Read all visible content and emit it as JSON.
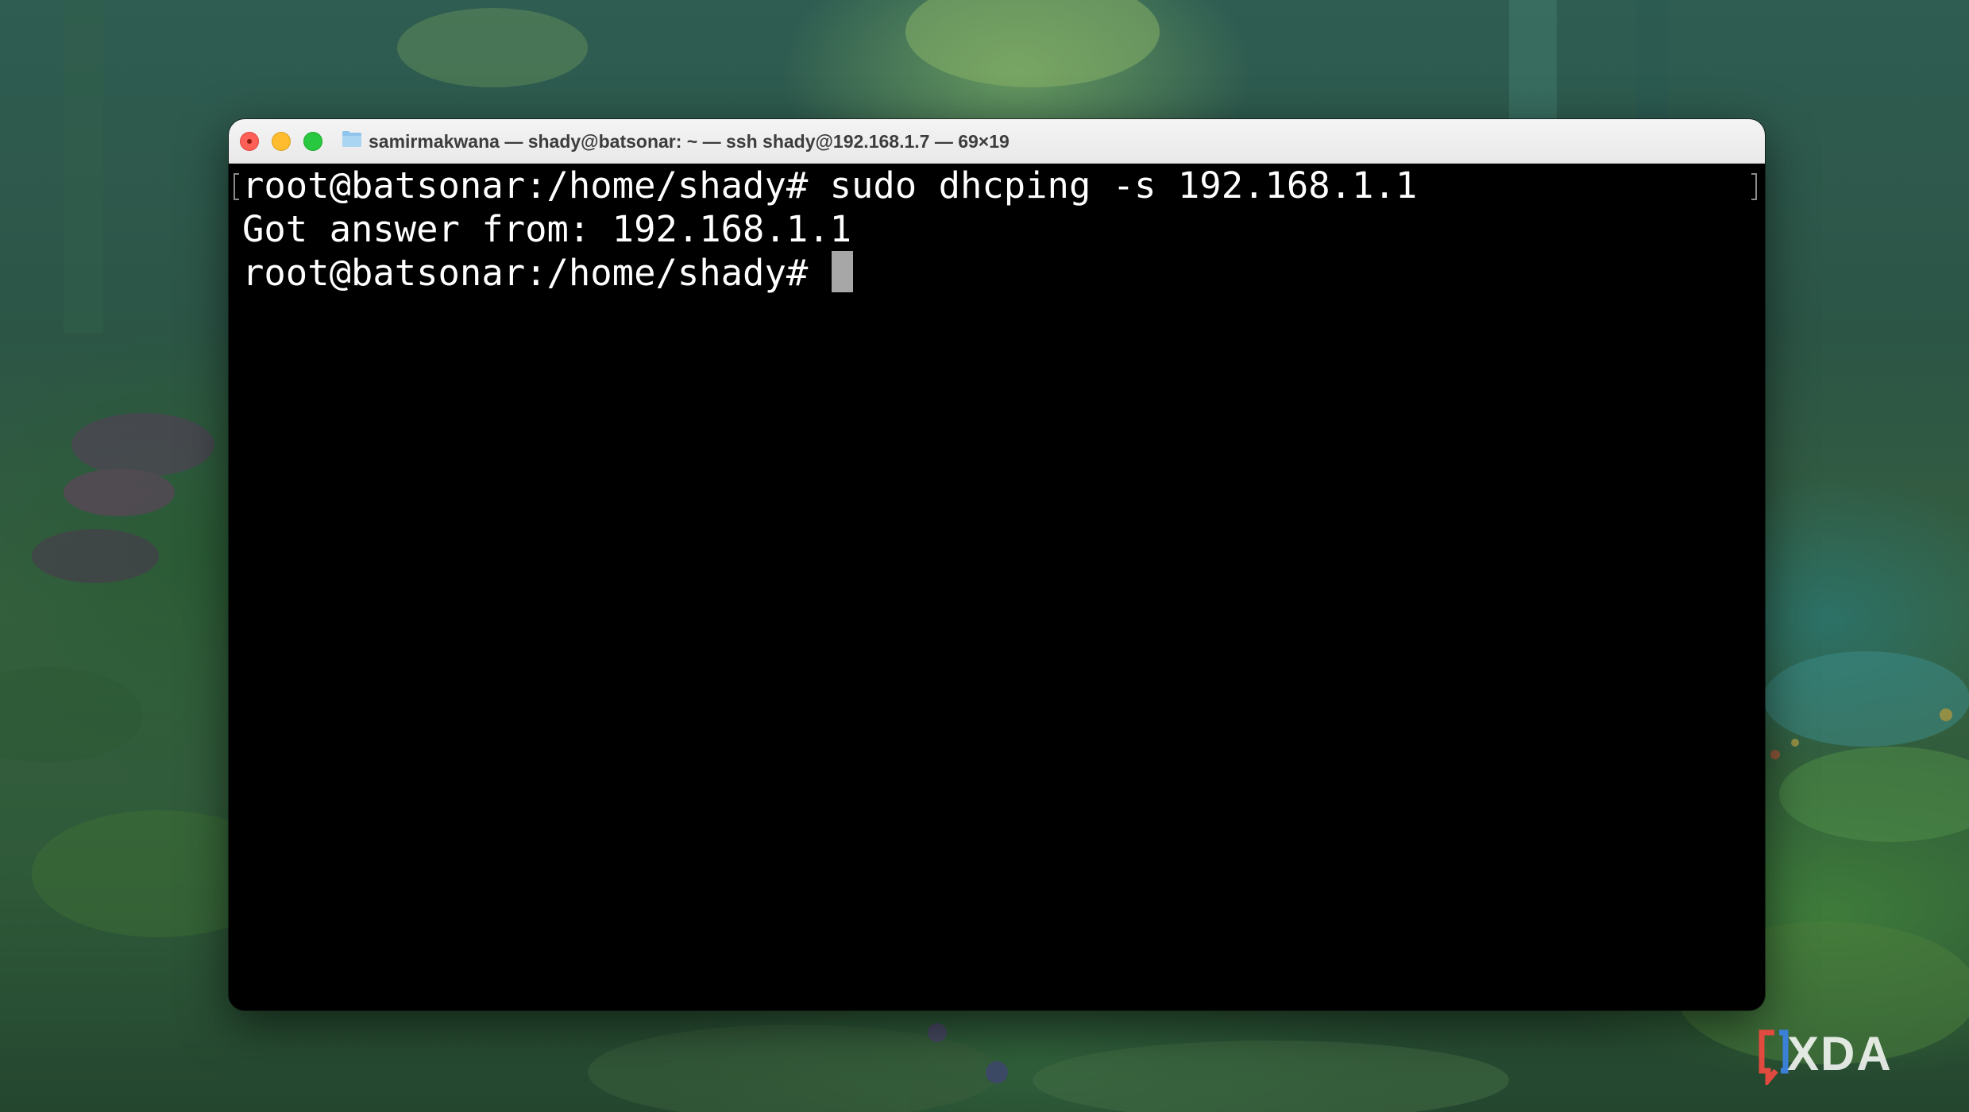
{
  "window": {
    "title": "samirmakwana — shady@batsonar: ~ — ssh shady@192.168.1.7 — 69×19",
    "controls": [
      "close-button",
      "minimize-button",
      "zoom-button"
    ],
    "title_icon": "folder-icon"
  },
  "terminal": {
    "lines": [
      "root@batsonar:/home/shady# sudo dhcping -s 192.168.1.1",
      "Got answer from: 192.168.1.1",
      "root@batsonar:/home/shady# "
    ]
  },
  "watermark": {
    "text": "XDA"
  },
  "colors": {
    "close": "#fe5f57",
    "minimize": "#febc2e",
    "zoom": "#28c840",
    "terminal_bg": "#000000",
    "terminal_fg": "#ffffff",
    "cursor": "#a7a7a7",
    "xda_red": "#e04a3f",
    "xda_blue": "#3b7fd6"
  }
}
